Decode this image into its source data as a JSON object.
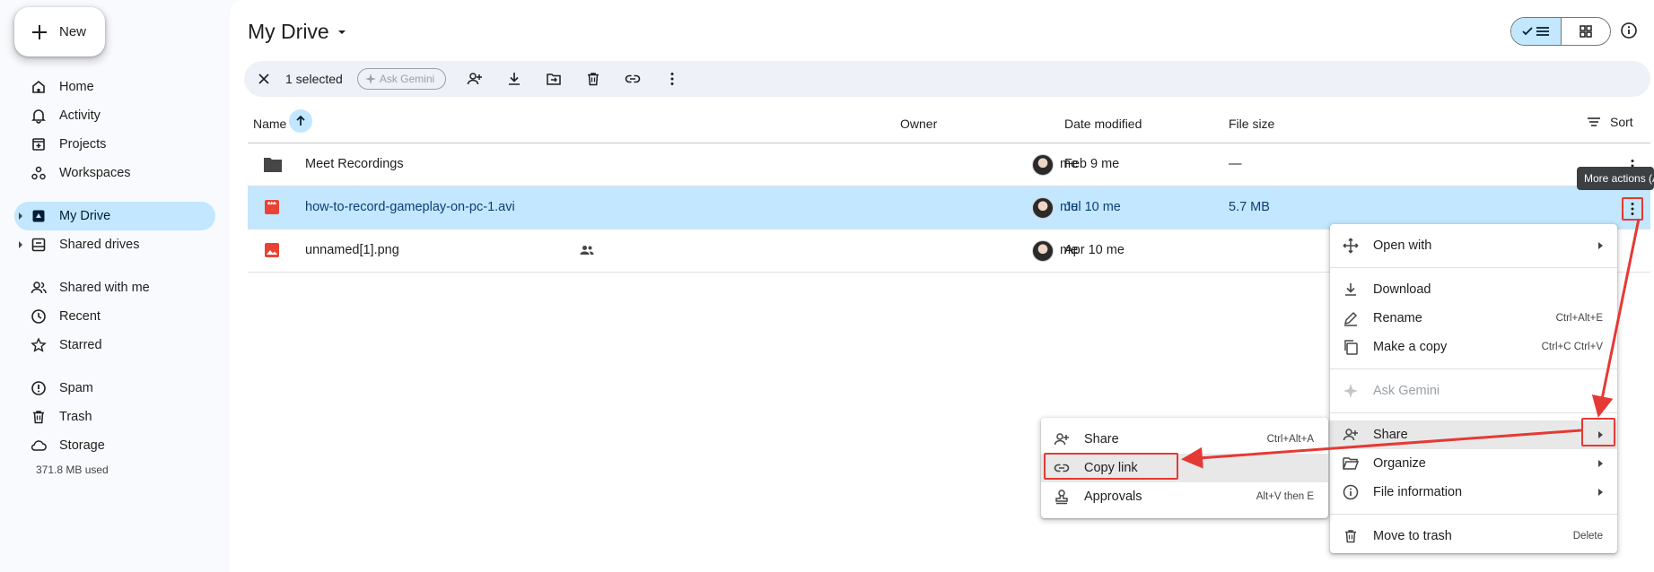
{
  "sidebar": {
    "new_label": "New",
    "items": [
      {
        "label": "Home",
        "icon": "home-icon"
      },
      {
        "label": "Activity",
        "icon": "bell-icon"
      },
      {
        "label": "Projects",
        "icon": "projects-icon"
      },
      {
        "label": "Workspaces",
        "icon": "workspaces-icon"
      },
      {
        "label": "My Drive",
        "icon": "drive-icon"
      },
      {
        "label": "Shared drives",
        "icon": "shared-drives-icon"
      },
      {
        "label": "Shared with me",
        "icon": "people-icon"
      },
      {
        "label": "Recent",
        "icon": "clock-icon"
      },
      {
        "label": "Starred",
        "icon": "star-icon"
      },
      {
        "label": "Spam",
        "icon": "spam-icon"
      },
      {
        "label": "Trash",
        "icon": "trash-icon"
      },
      {
        "label": "Storage",
        "icon": "cloud-icon"
      }
    ],
    "storage_used": "371.8 MB used"
  },
  "header": {
    "title": "My Drive"
  },
  "toolbar": {
    "selected_text": "1 selected",
    "ask_gemini": "Ask Gemini"
  },
  "table": {
    "columns": {
      "name": "Name",
      "owner": "Owner",
      "date": "Date modified",
      "size": "File size",
      "sort": "Sort"
    },
    "rows": [
      {
        "name": "Meet Recordings",
        "owner": "me",
        "date": "Feb 9 me",
        "size": "—"
      },
      {
        "name": "how-to-record-gameplay-on-pc-1.avi",
        "owner": "me",
        "date": "Jul 10 me",
        "size": "5.7 MB"
      },
      {
        "name": "unnamed[1].png",
        "owner": "me",
        "date": "Apr 10 me",
        "size": ""
      }
    ]
  },
  "tooltip": "More actions (Alt+A)",
  "context_menu": {
    "open_with": "Open with",
    "download": "Download",
    "rename": "Rename",
    "rename_sc": "Ctrl+Alt+E",
    "copy": "Make a copy",
    "copy_sc": "Ctrl+C Ctrl+V",
    "gemini": "Ask Gemini",
    "share": "Share",
    "organize": "Organize",
    "file_info": "File information",
    "trash": "Move to trash",
    "trash_sc": "Delete"
  },
  "share_menu": {
    "share": "Share",
    "share_sc": "Ctrl+Alt+A",
    "copy_link": "Copy link",
    "approvals": "Approvals",
    "approvals_sc": "Alt+V then E"
  },
  "colors": {
    "accent": "#c2e7ff",
    "annotation": "#e53935"
  }
}
